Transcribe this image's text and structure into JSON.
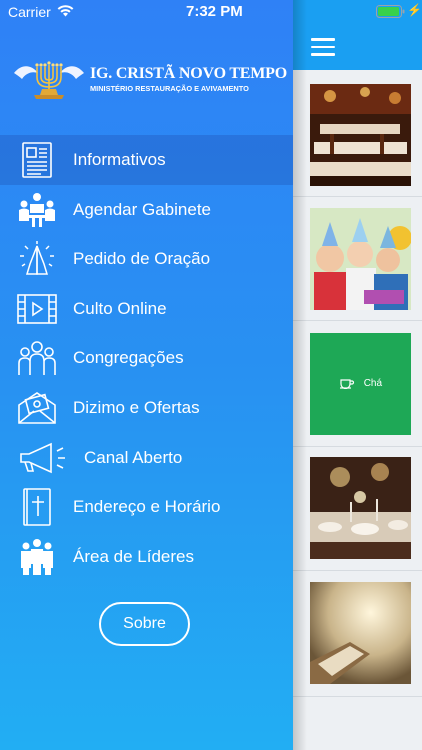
{
  "status_bar": {
    "carrier": "Carrier",
    "time": "7:32 PM"
  },
  "brand": {
    "title": "IG. CRISTÃ NOVO TEMPO",
    "subtitle": "MINISTÉRIO RESTAURAÇÃO E AVIVAMENTO"
  },
  "menu": {
    "items": [
      {
        "label": "Informativos",
        "icon": "newspaper-icon",
        "active": true
      },
      {
        "label": "Agendar Gabinete",
        "icon": "meeting-icon"
      },
      {
        "label": "Pedido de Oração",
        "icon": "praying-hands-icon"
      },
      {
        "label": "Culto Online",
        "icon": "video-film-icon"
      },
      {
        "label": "Congregações",
        "icon": "people-group-icon"
      },
      {
        "label": "Dizimo e Ofertas",
        "icon": "money-envelope-icon"
      },
      {
        "label": "Canal Aberto",
        "icon": "megaphone-icon"
      },
      {
        "label": "Endereço e Horário",
        "icon": "bible-icon"
      },
      {
        "label": "Área de Líderes",
        "icon": "leaders-group-icon"
      }
    ]
  },
  "sobre_button": {
    "label": "Sobre"
  },
  "feed": {
    "cards": [
      {
        "kind": "photo",
        "icon": "restaurant-photo"
      },
      {
        "kind": "photo",
        "icon": "kids-party-photo"
      },
      {
        "kind": "tile",
        "label": "Chá",
        "icon": "tea-cup-icon",
        "color": "#1ea856"
      },
      {
        "kind": "photo",
        "icon": "dinner-table-photo"
      },
      {
        "kind": "photo",
        "icon": "bible-light-photo"
      }
    ]
  },
  "colors": {
    "drawer_top": "#2f81f6",
    "drawer_bottom": "#22aef3",
    "header": "#1a9ff2",
    "cha_tile": "#1ea856"
  }
}
